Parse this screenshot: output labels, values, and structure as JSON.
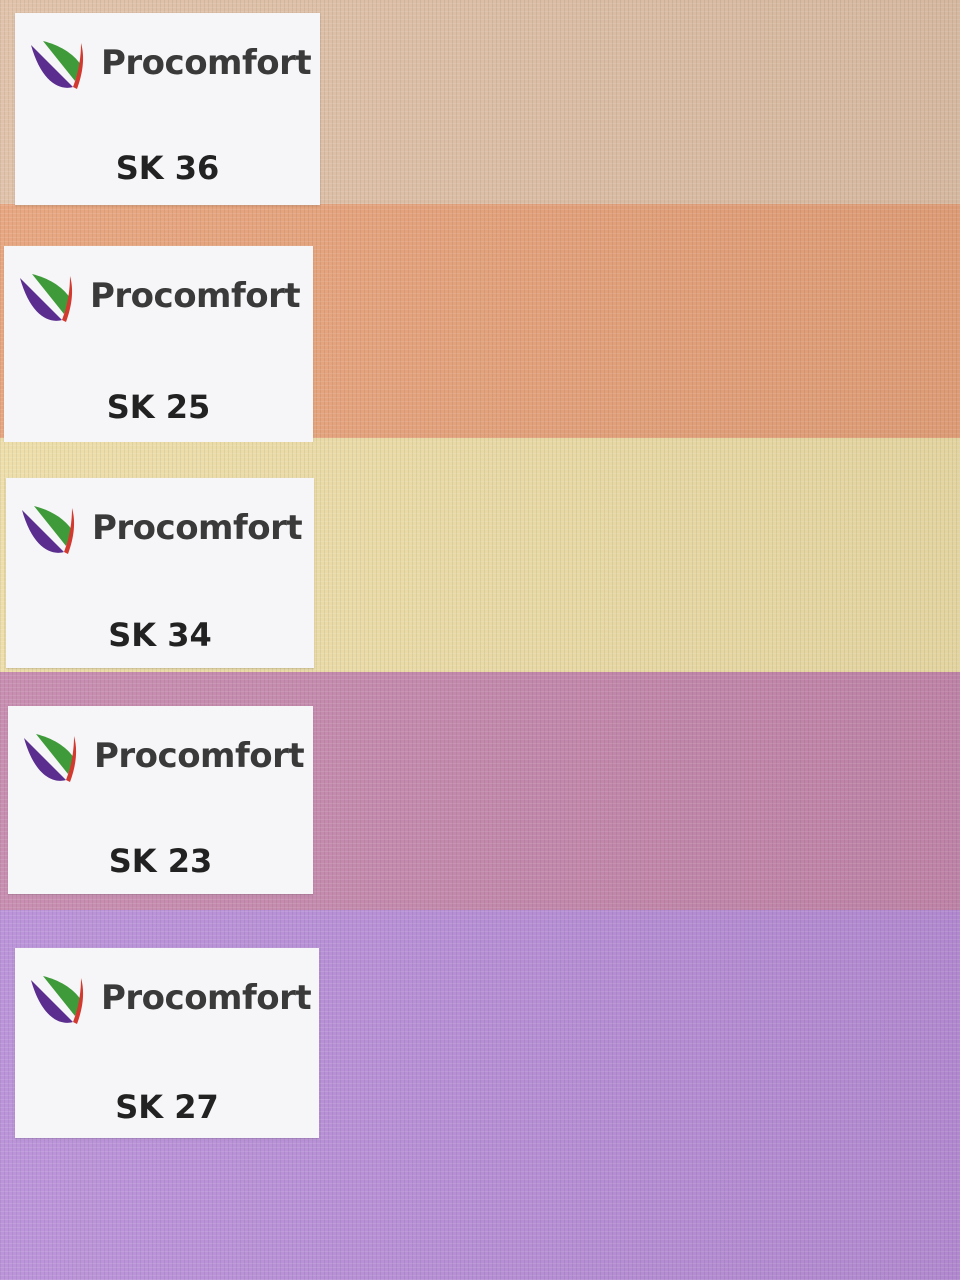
{
  "swatches": [
    {
      "brand": "Procomfort",
      "code": "SK 36",
      "color": "#dfbfa6"
    },
    {
      "brand": "Procomfort",
      "code": "SK 25",
      "color": "#e6a27a"
    },
    {
      "brand": "Procomfort",
      "code": "SK 34",
      "color": "#ecdca6"
    },
    {
      "brand": "Procomfort",
      "code": "SK 23",
      "color": "#c588ad"
    },
    {
      "brand": "Procomfort",
      "code": "SK 27",
      "color": "#b88ed7"
    }
  ],
  "logo_colors": {
    "purple": "#5b2d8f",
    "green": "#3f9b3a",
    "red": "#d23a2f"
  },
  "label_color": "#f6f6f8"
}
